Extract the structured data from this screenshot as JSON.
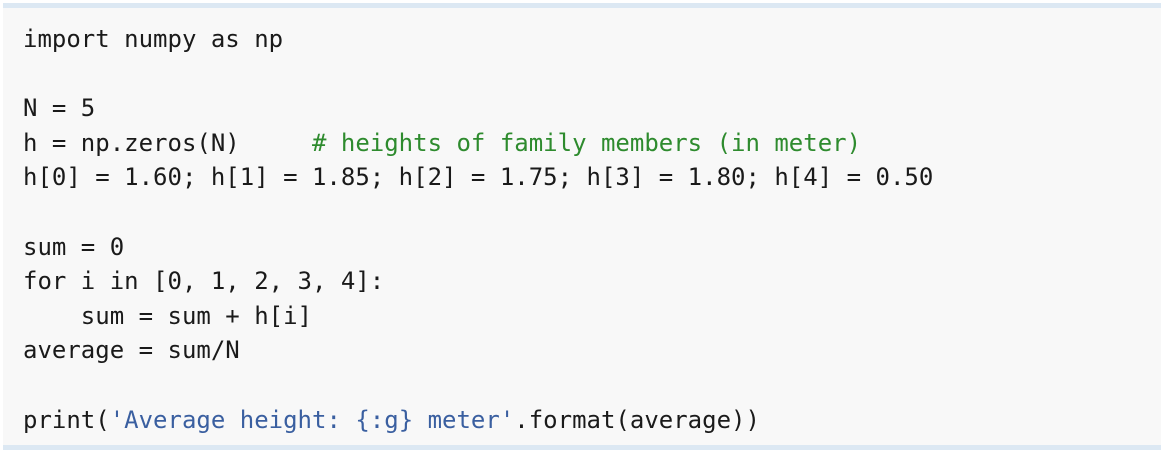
{
  "code": {
    "language": "python",
    "lines": [
      {
        "segments": [
          {
            "text": "import numpy as np",
            "kind": "plain"
          }
        ]
      },
      {
        "segments": []
      },
      {
        "segments": [
          {
            "text": "N = 5",
            "kind": "plain"
          }
        ]
      },
      {
        "segments": [
          {
            "text": "h = np.zeros(N)     ",
            "kind": "plain"
          },
          {
            "text": "# heights of family members (in meter)",
            "kind": "comment"
          }
        ]
      },
      {
        "segments": [
          {
            "text": "h[0] = 1.60; h[1] = 1.85; h[2] = 1.75; h[3] = 1.80; h[4] = 0.50",
            "kind": "plain"
          }
        ]
      },
      {
        "segments": []
      },
      {
        "segments": [
          {
            "text": "sum = 0",
            "kind": "plain"
          }
        ]
      },
      {
        "segments": [
          {
            "text": "for i in [0, 1, 2, 3, 4]:",
            "kind": "plain"
          }
        ]
      },
      {
        "segments": [
          {
            "text": "    sum = sum + h[i]",
            "kind": "plain"
          }
        ]
      },
      {
        "segments": [
          {
            "text": "average = sum/N",
            "kind": "plain"
          }
        ]
      },
      {
        "segments": []
      },
      {
        "segments": [
          {
            "text": "print(",
            "kind": "plain"
          },
          {
            "text": "'Average height: {:g} meter'",
            "kind": "string"
          },
          {
            "text": ".format(average))",
            "kind": "plain"
          }
        ]
      }
    ]
  },
  "colors": {
    "background": "#f8f8f8",
    "border": "#dce8f3",
    "text": "#1a1a1a",
    "comment": "#2e8b2e",
    "string": "#3a5fa0"
  }
}
